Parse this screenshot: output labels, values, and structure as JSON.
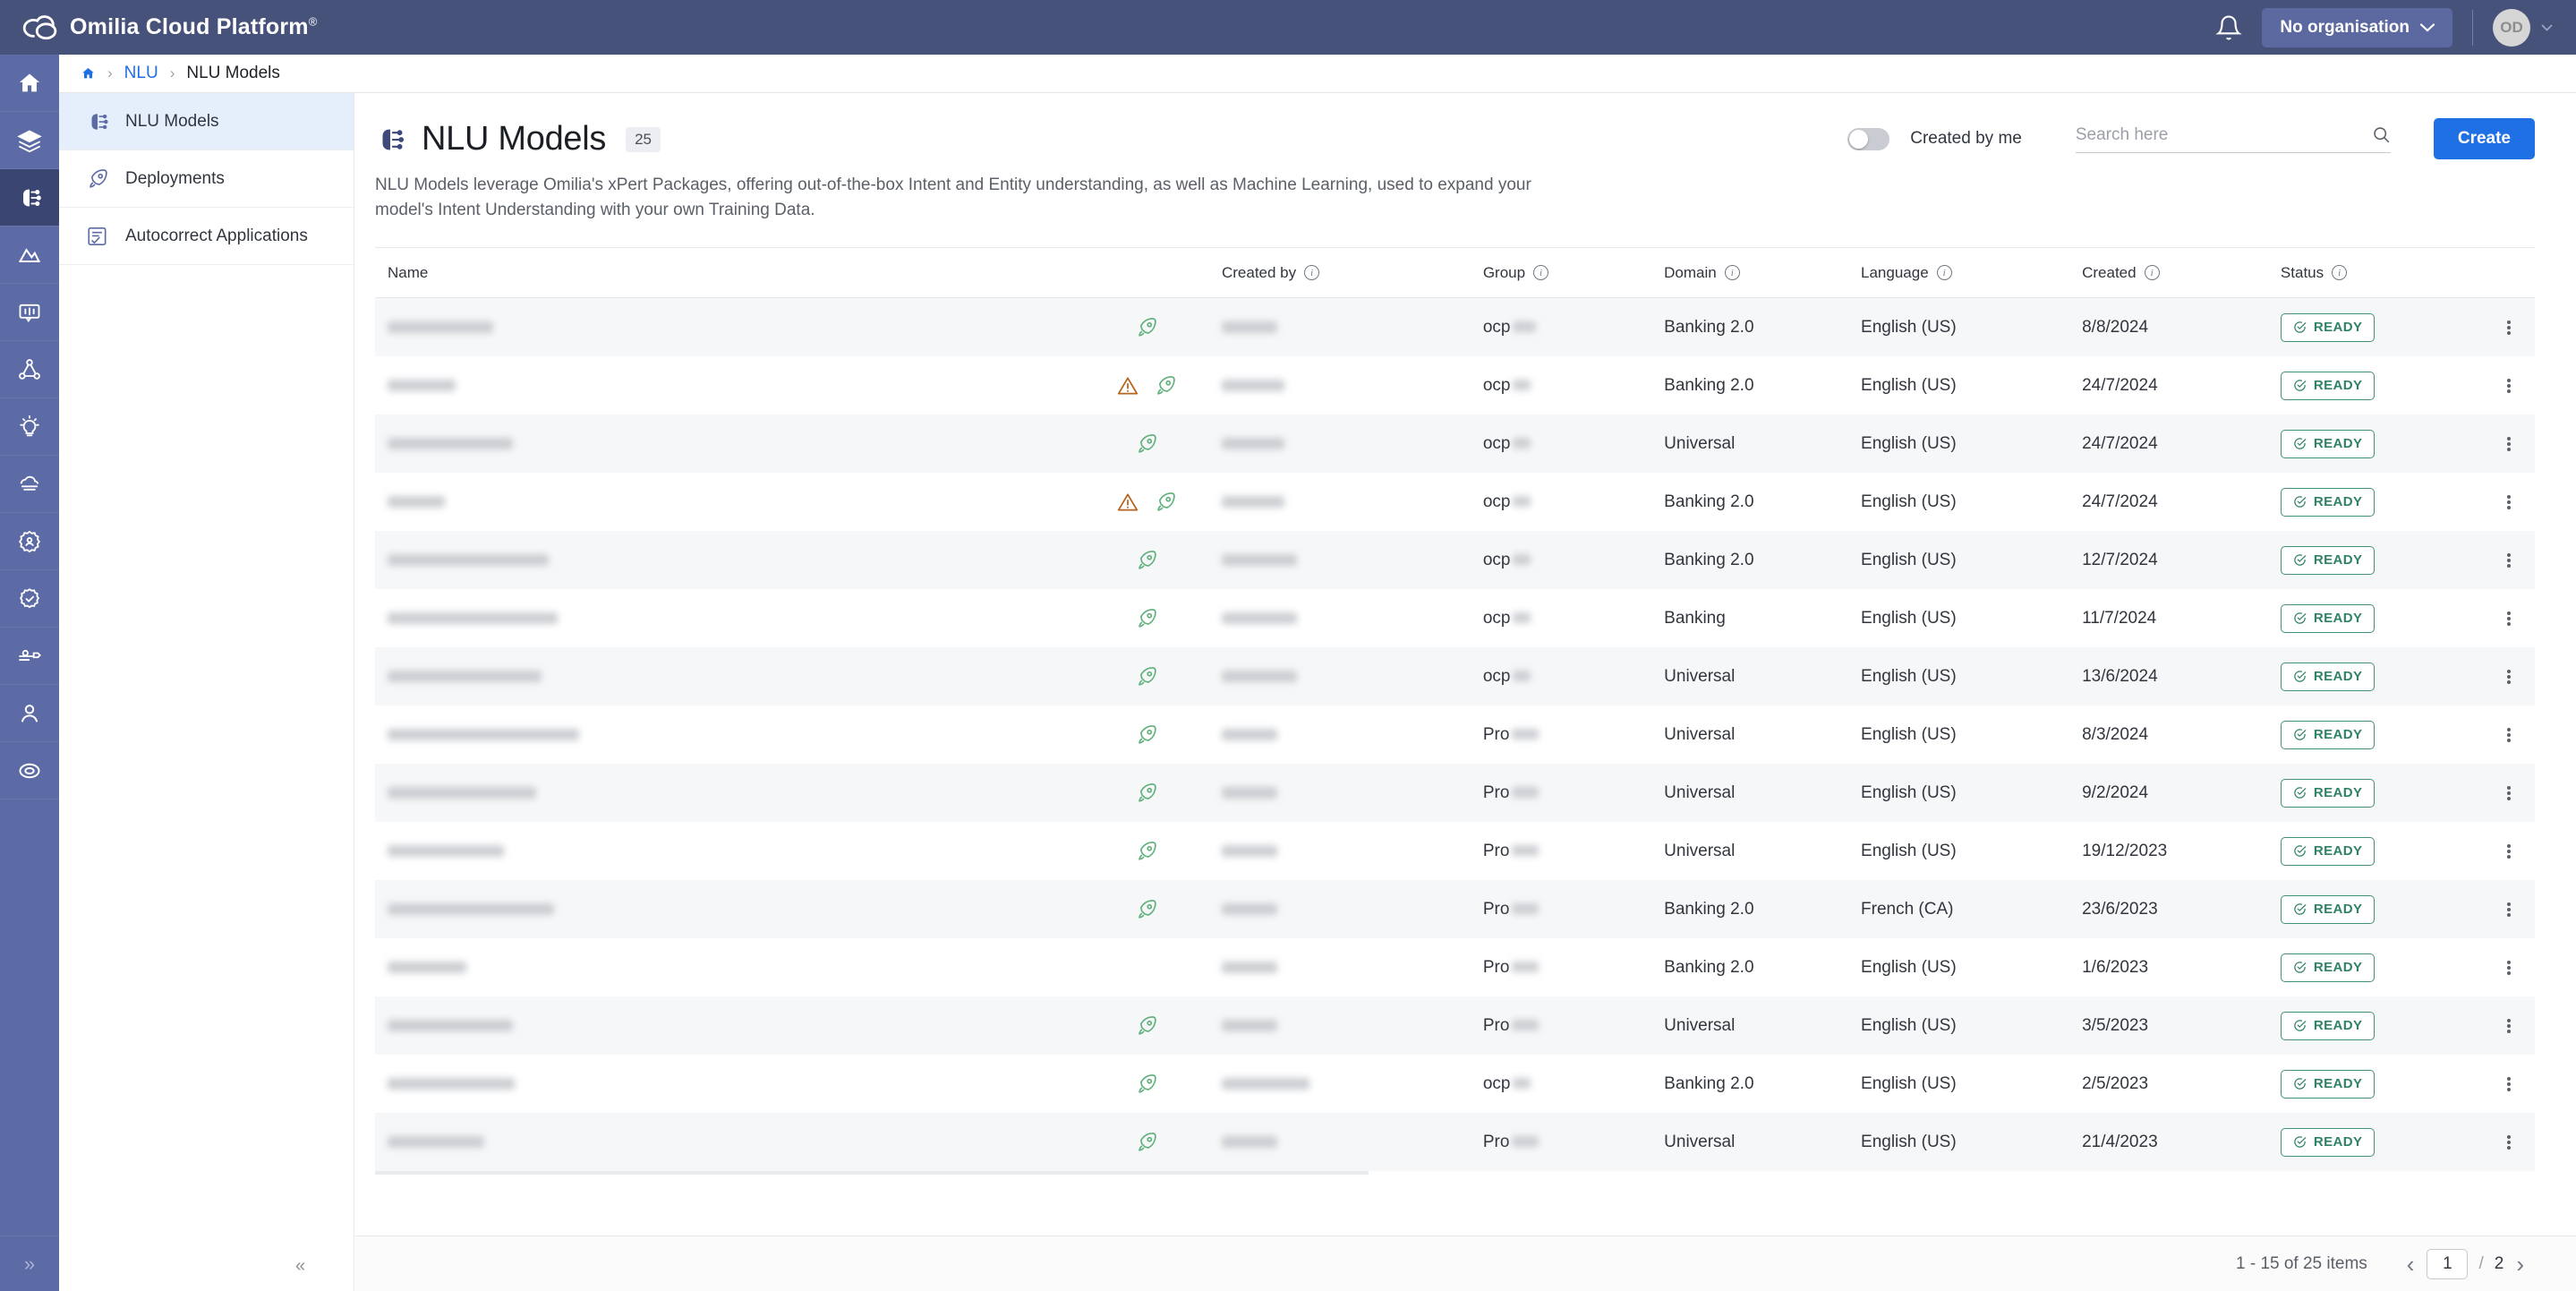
{
  "topbar": {
    "brand": "Omilia Cloud Platform",
    "brand_registered": "®",
    "notifications_icon": "bell-icon",
    "organisation_label": "No organisation",
    "avatar_initials": "OD"
  },
  "breadcrumb": {
    "home_icon": "home-icon",
    "separator": "›",
    "link": "NLU",
    "current": "NLU Models"
  },
  "rail": {
    "items": [
      {
        "icon": "home-icon",
        "active": false
      },
      {
        "icon": "layers-icon",
        "active": false
      },
      {
        "icon": "nlu-brain-icon",
        "active": true
      },
      {
        "icon": "analytics-icon",
        "active": false
      },
      {
        "icon": "speech-bubble-icon",
        "active": false
      },
      {
        "icon": "flow-nodes-icon",
        "active": false
      },
      {
        "icon": "lightbulb-icon",
        "active": false
      },
      {
        "icon": "cloud-stack-icon",
        "active": false
      },
      {
        "icon": "gear-user-icon",
        "active": false
      },
      {
        "icon": "shield-check-icon",
        "active": false
      },
      {
        "icon": "tools-icon",
        "active": false
      },
      {
        "icon": "user-icon",
        "active": false
      },
      {
        "icon": "lifebuoy-icon",
        "active": false
      }
    ],
    "expand_icon": "chevron-double-right-icon"
  },
  "nav": {
    "items": [
      {
        "label": "NLU Models",
        "icon": "nlu-brain-icon",
        "active": true
      },
      {
        "label": "Deployments",
        "icon": "rocket-icon",
        "active": false
      },
      {
        "label": "Autocorrect Applications",
        "icon": "autocorrect-icon",
        "active": false
      }
    ],
    "collapse_icon": "chevron-double-left-icon"
  },
  "page": {
    "icon": "nlu-brain-icon",
    "title": "NLU Models",
    "count": "25",
    "description": "NLU Models leverage Omilia's xPert Packages, offering out-of-the-box Intent and Entity understanding, as well as Machine Learning, used to expand your model's Intent Understanding with your own Training Data."
  },
  "tools": {
    "created_by_me_label": "Created by me",
    "created_by_me_on": false,
    "search_placeholder": "Search here",
    "search_value": "",
    "search_icon": "search-icon",
    "create_label": "Create"
  },
  "table": {
    "columns": [
      {
        "label": "Name",
        "info": false
      },
      {
        "label": "",
        "info": false
      },
      {
        "label": "Created by",
        "info": true
      },
      {
        "label": "Group",
        "info": true
      },
      {
        "label": "Domain",
        "info": true
      },
      {
        "label": "Language",
        "info": true
      },
      {
        "label": "Created",
        "info": true
      },
      {
        "label": "Status",
        "info": true
      }
    ],
    "status_ready_label": "READY",
    "rows": [
      {
        "name_w": 118,
        "author_w": 62,
        "group_prefix": "ocp",
        "group_w": 26,
        "domain": "Banking 2.0",
        "language": "English (US)",
        "created": "8/8/2024",
        "status": "READY",
        "warning": false,
        "deployed": true
      },
      {
        "name_w": 76,
        "author_w": 70,
        "group_prefix": "ocp",
        "group_w": 20,
        "domain": "Banking 2.0",
        "language": "English (US)",
        "created": "24/7/2024",
        "status": "READY",
        "warning": true,
        "deployed": true
      },
      {
        "name_w": 140,
        "author_w": 70,
        "group_prefix": "ocp",
        "group_w": 20,
        "domain": "Universal",
        "language": "English (US)",
        "created": "24/7/2024",
        "status": "READY",
        "warning": false,
        "deployed": true
      },
      {
        "name_w": 64,
        "author_w": 70,
        "group_prefix": "ocp",
        "group_w": 20,
        "domain": "Banking 2.0",
        "language": "English (US)",
        "created": "24/7/2024",
        "status": "READY",
        "warning": true,
        "deployed": true
      },
      {
        "name_w": 180,
        "author_w": 84,
        "group_prefix": "ocp",
        "group_w": 20,
        "domain": "Banking 2.0",
        "language": "English (US)",
        "created": "12/7/2024",
        "status": "READY",
        "warning": false,
        "deployed": true
      },
      {
        "name_w": 190,
        "author_w": 84,
        "group_prefix": "ocp",
        "group_w": 20,
        "domain": "Banking",
        "language": "English (US)",
        "created": "11/7/2024",
        "status": "READY",
        "warning": false,
        "deployed": true
      },
      {
        "name_w": 172,
        "author_w": 84,
        "group_prefix": "ocp",
        "group_w": 20,
        "domain": "Universal",
        "language": "English (US)",
        "created": "13/6/2024",
        "status": "READY",
        "warning": false,
        "deployed": true
      },
      {
        "name_w": 214,
        "author_w": 62,
        "group_prefix": "Pro",
        "group_w": 30,
        "domain": "Universal",
        "language": "English (US)",
        "created": "8/3/2024",
        "status": "READY",
        "warning": false,
        "deployed": true
      },
      {
        "name_w": 166,
        "author_w": 62,
        "group_prefix": "Pro",
        "group_w": 30,
        "domain": "Universal",
        "language": "English (US)",
        "created": "9/2/2024",
        "status": "READY",
        "warning": false,
        "deployed": true
      },
      {
        "name_w": 130,
        "author_w": 62,
        "group_prefix": "Pro",
        "group_w": 30,
        "domain": "Universal",
        "language": "English (US)",
        "created": "19/12/2023",
        "status": "READY",
        "warning": false,
        "deployed": true
      },
      {
        "name_w": 186,
        "author_w": 62,
        "group_prefix": "Pro",
        "group_w": 30,
        "domain": "Banking 2.0",
        "language": "French (CA)",
        "created": "23/6/2023",
        "status": "READY",
        "warning": false,
        "deployed": true
      },
      {
        "name_w": 88,
        "author_w": 62,
        "group_prefix": "Pro",
        "group_w": 30,
        "domain": "Banking 2.0",
        "language": "English (US)",
        "created": "1/6/2023",
        "status": "READY",
        "warning": false,
        "deployed": false
      },
      {
        "name_w": 140,
        "author_w": 62,
        "group_prefix": "Pro",
        "group_w": 30,
        "domain": "Universal",
        "language": "English (US)",
        "created": "3/5/2023",
        "status": "READY",
        "warning": false,
        "deployed": true
      },
      {
        "name_w": 142,
        "author_w": 98,
        "group_prefix": "ocp",
        "group_w": 20,
        "domain": "Banking 2.0",
        "language": "English (US)",
        "created": "2/5/2023",
        "status": "READY",
        "warning": false,
        "deployed": true
      },
      {
        "name_w": 108,
        "author_w": 62,
        "group_prefix": "Pro",
        "group_w": 30,
        "domain": "Universal",
        "language": "English (US)",
        "created": "21/4/2023",
        "status": "READY",
        "warning": false,
        "deployed": true
      }
    ]
  },
  "footer": {
    "range_text": "1 - 15 of 25 items",
    "prev_icon": "chevron-left-icon",
    "next_icon": "chevron-right-icon",
    "current_page": "1",
    "slash": "/",
    "total_pages": "2"
  },
  "colors": {
    "brand_header": "#47527a",
    "rail": "#5c6ba5",
    "accent": "#1f6fe5",
    "nav_active": "#e5effc",
    "status_ready": "#2f8268",
    "warning": "#b5631d",
    "rocket": "#5fb07a"
  }
}
